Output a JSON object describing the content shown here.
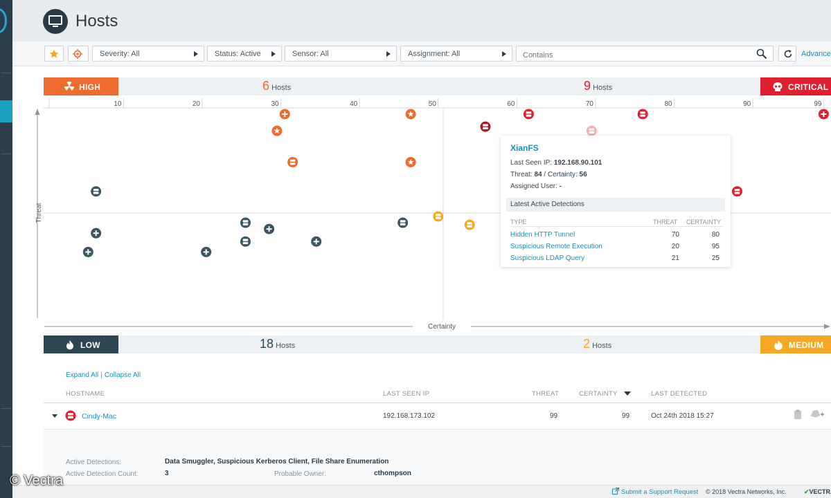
{
  "page": {
    "title": "Hosts"
  },
  "filters": {
    "severity": "Severity: All",
    "status": "Status: Active",
    "sensor": "Sensor: All",
    "assignment": "Assignment: All",
    "search_placeholder": "Contains",
    "advanced_label": "Advanced"
  },
  "quadrants": {
    "high": {
      "label": "HIGH",
      "count": "6",
      "unit": "Hosts"
    },
    "critical": {
      "label": "CRITICAL",
      "count": "9",
      "unit": "Hosts"
    },
    "low": {
      "label": "LOW",
      "count": "18",
      "unit": "Hosts"
    },
    "medium": {
      "label": "MEDIUM",
      "count": "2",
      "unit": "Hosts"
    }
  },
  "chart": {
    "ylabel": "Threat",
    "xlabel": "Certainty",
    "ticks": [
      "10",
      "20",
      "30",
      "40",
      "50",
      "60",
      "70",
      "80",
      "90",
      "99"
    ],
    "colors": {
      "high": "#ec6b2d",
      "critical": "#e0202e",
      "low": "#3a5663",
      "medium": "#f7a823",
      "selected": "#a31c27"
    }
  },
  "chart_data": {
    "type": "scatter",
    "xlabel": "Certainty",
    "ylabel": "Threat",
    "xlim": [
      0,
      100
    ],
    "points": [
      {
        "x": 30.5,
        "y": 90,
        "quadrant": "high",
        "icon": "plus"
      },
      {
        "x": 46.5,
        "y": 90,
        "quadrant": "high",
        "icon": "star"
      },
      {
        "x": 29.5,
        "y": 82,
        "quadrant": "high",
        "icon": "star"
      },
      {
        "x": 31.5,
        "y": 67,
        "quadrant": "high",
        "icon": "server"
      },
      {
        "x": 46.5,
        "y": 67,
        "quadrant": "high",
        "icon": "star"
      },
      {
        "x": 61.5,
        "y": 90,
        "quadrant": "critical",
        "icon": "server"
      },
      {
        "x": 76,
        "y": 90,
        "quadrant": "critical",
        "icon": "server"
      },
      {
        "x": 99,
        "y": 90,
        "quadrant": "critical",
        "icon": "plus"
      },
      {
        "x": 56,
        "y": 84,
        "quadrant": "critical",
        "icon": "server",
        "selected": true
      },
      {
        "x": 69.5,
        "y": 82,
        "quadrant": "critical",
        "icon": "server",
        "faded": true
      },
      {
        "x": 88,
        "y": 53,
        "quadrant": "critical",
        "icon": "server"
      },
      {
        "x": 50,
        "y": 41,
        "quadrant": "medium",
        "icon": "server"
      },
      {
        "x": 54,
        "y": 37,
        "quadrant": "medium",
        "icon": "server"
      },
      {
        "x": 6.5,
        "y": 53,
        "quadrant": "low",
        "icon": "server"
      },
      {
        "x": 6.5,
        "y": 33,
        "quadrant": "low",
        "icon": "plus"
      },
      {
        "x": 5.5,
        "y": 24,
        "quadrant": "low",
        "icon": "plus"
      },
      {
        "x": 20.5,
        "y": 24,
        "quadrant": "low",
        "icon": "plus"
      },
      {
        "x": 25.5,
        "y": 38,
        "quadrant": "low",
        "icon": "server"
      },
      {
        "x": 28.5,
        "y": 35,
        "quadrant": "low",
        "icon": "plus"
      },
      {
        "x": 25.5,
        "y": 29,
        "quadrant": "low",
        "icon": "server"
      },
      {
        "x": 34.5,
        "y": 29,
        "quadrant": "low",
        "icon": "plus"
      },
      {
        "x": 45.5,
        "y": 38,
        "quadrant": "low",
        "icon": "server"
      }
    ]
  },
  "tooltip": {
    "name": "XianFS",
    "ip_label": "Last Seen IP:",
    "ip": "192.168.90.101",
    "threat_label": "Threat:",
    "threat": "84",
    "certainty_label": "/ Certainty:",
    "certainty": "56",
    "user_label": "Assigned User:",
    "user": "-",
    "section": "Latest Active Detections",
    "col_type": "TYPE",
    "col_threat": "THREAT",
    "col_certainty": "CERTAINTY",
    "rows": [
      {
        "type": "Hidden HTTP Tunnel",
        "threat": "70",
        "certainty": "80"
      },
      {
        "type": "Suspicious Remote Execution",
        "threat": "20",
        "certainty": "95"
      },
      {
        "type": "Suspicious LDAP Query",
        "threat": "21",
        "certainty": "25"
      }
    ]
  },
  "table": {
    "expand_all": "Expand All",
    "collapse_all": "Collapse All",
    "headers": {
      "hostname": "HOSTNAME",
      "ip": "LAST SEEN IP",
      "threat": "THREAT",
      "certainty": "CERTAINTY",
      "detected": "LAST DETECTED"
    },
    "rows": [
      {
        "hostname": "Cindy-Mac",
        "ip": "192.168.173.102",
        "threat": "99",
        "certainty": "99",
        "detected": "Oct 24th 2018 15:27"
      }
    ],
    "detail": {
      "active_label": "Active Detections:",
      "active_value": "Data Smuggler, Suspicious Kerberos Client, File Share Enumeration",
      "count_label": "Active Detection Count:",
      "count_value": "3",
      "owner_label": "Probable Owner:",
      "owner_value": "cthompson"
    }
  },
  "footer": {
    "support": "Submit a Support Request",
    "copyright": "© 2018 Vectra Networks, Inc.",
    "brand": "VECTRA"
  },
  "watermark": "© Vectra"
}
